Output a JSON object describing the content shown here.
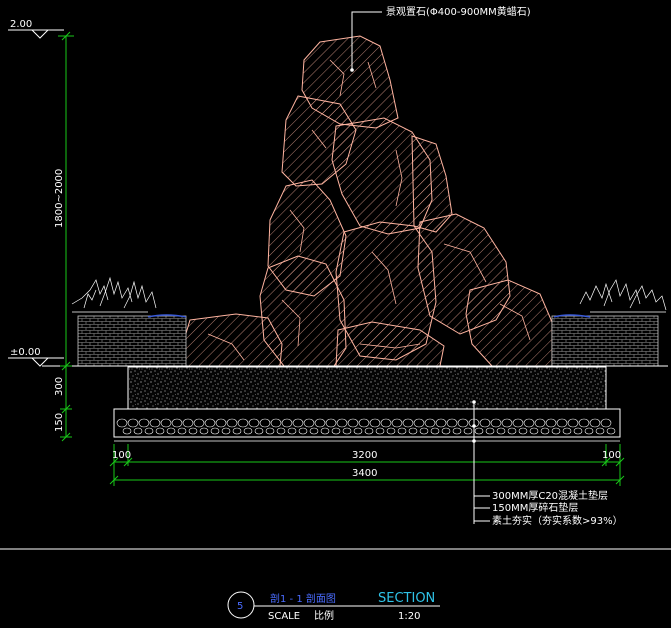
{
  "callouts": {
    "rock": "景观置石(Φ400-900MM黄蜡石)",
    "concrete": "300MM厚C20混凝土垫层",
    "gravel": "150MM厚碎石垫层",
    "soil": "素土夯实（夯实系数>93%）"
  },
  "levels": {
    "top": "2.00",
    "ground": "±0.00"
  },
  "dimensions": {
    "height": "1800~2000",
    "concrete_thickness": "300",
    "gravel_thickness": "150",
    "left_margin": "100",
    "inner_width": "3200",
    "right_margin": "100",
    "total_width": "3400"
  },
  "title_block": {
    "number": "5",
    "name": "剖1 - 1 剖面图",
    "type": "SECTION",
    "scale_label": "SCALE",
    "scale_cn": "比例",
    "scale_value": "1:20"
  },
  "colors": {
    "background": "#000000",
    "dimension": "#19c819",
    "rock_outline": "#ffb4a0",
    "white": "#ffffff",
    "title_blue": "#4a6cff",
    "title_cyan": "#2fc3e8",
    "water": "#3a5bd9"
  }
}
